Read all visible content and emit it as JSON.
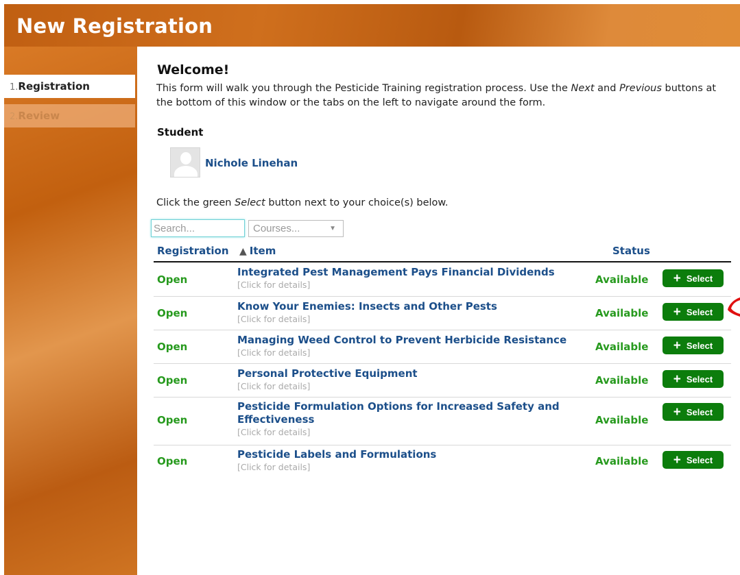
{
  "window": {
    "title": "New Registration"
  },
  "tabs": [
    {
      "num": "1.",
      "label": "Registration"
    },
    {
      "num": "2.",
      "label": "Review"
    }
  ],
  "welcome": {
    "title": "Welcome!",
    "text_1": "This form will walk you through the Pesticide Training registration process. Use the ",
    "next": "Next",
    "text_2": " and ",
    "previous": "Previous",
    "text_3": " buttons at the bottom of this window or the tabs on the left to navigate around the form."
  },
  "student": {
    "label": "Student",
    "name": "Nichole Linehan"
  },
  "instructions": {
    "text_1": "Click the green ",
    "select": "Select",
    "text_2": " button next to your choice(s) below."
  },
  "filters": {
    "search_placeholder": "Search...",
    "courses_label": "Courses...",
    "courses_arrow": "▼"
  },
  "table": {
    "headers": {
      "registration": "Registration",
      "item_sort": "▲",
      "item": "Item",
      "status": "Status"
    },
    "rows": [
      {
        "registration": "Open",
        "title": "Integrated Pest Management Pays Financial Dividends",
        "details": "[Click for details]",
        "status": "Available",
        "button": "Select"
      },
      {
        "registration": "Open",
        "title": "Know Your Enemies: Insects and Other Pests",
        "details": "[Click for details]",
        "status": "Available",
        "button": "Select"
      },
      {
        "registration": "Open",
        "title": "Managing Weed Control to Prevent Herbicide Resistance",
        "details": "[Click for details]",
        "status": "Available",
        "button": "Select"
      },
      {
        "registration": "Open",
        "title": "Personal Protective Equipment",
        "details": "[Click for details]",
        "status": "Available",
        "button": "Select"
      },
      {
        "registration": "Open",
        "title": "Pesticide Formulation Options for Increased Safety and Effectiveness",
        "details": "[Click for details]",
        "status": "Available",
        "button": "Select"
      },
      {
        "registration": "Open",
        "title": "Pesticide Labels and Formulations",
        "details": "[Click for details]",
        "status": "Available",
        "button": "Select"
      }
    ]
  },
  "colors": {
    "header_orange": "#c05f12",
    "link_blue": "#1c4f8a",
    "status_green": "#279a1e",
    "button_green": "#0c7d0c",
    "annotation_red": "#e01010"
  },
  "icons": {
    "plus": "+",
    "sort": "sort-ascending-icon",
    "avatar": "user-placeholder-icon"
  }
}
